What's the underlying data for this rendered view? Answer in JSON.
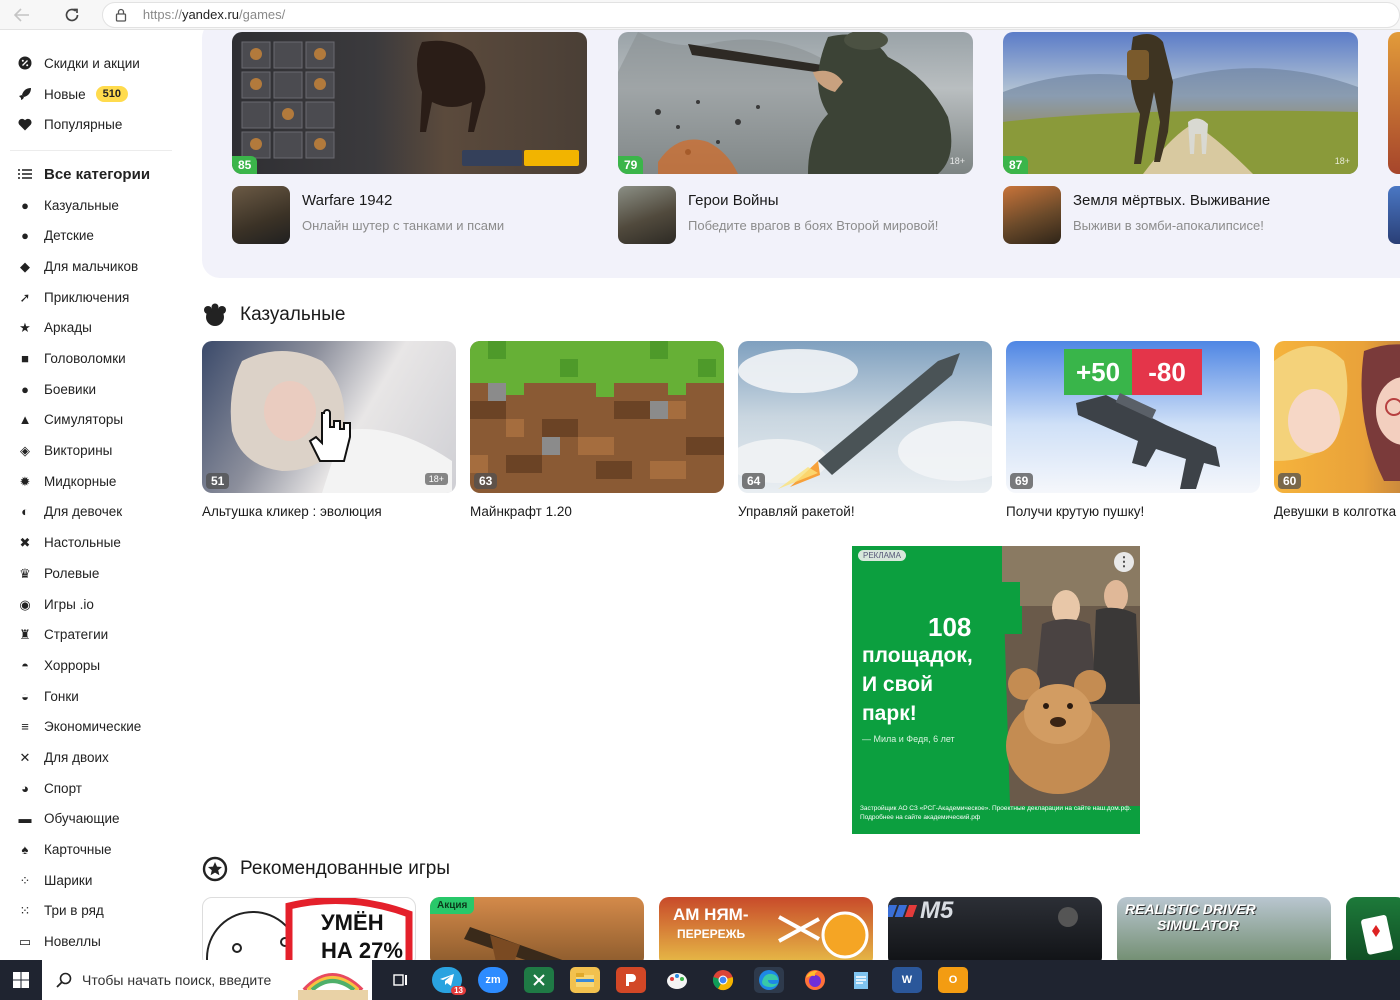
{
  "browser": {
    "url_protocol": "https://",
    "url_host": "yandex.ru",
    "url_path": "/games/"
  },
  "sidebar": {
    "top_items": [
      {
        "label": "Скидки и акции",
        "icon": "percent-icon"
      },
      {
        "label": "Новые",
        "icon": "rocket-icon",
        "badge": "510"
      },
      {
        "label": "Популярные",
        "icon": "heart-icon"
      }
    ],
    "categories_heading": "Все категории",
    "categories": [
      {
        "label": "Казуальные",
        "icon": "casual-icon"
      },
      {
        "label": "Детские",
        "icon": "kids-icon"
      },
      {
        "label": "Для мальчиков",
        "icon": "boys-icon"
      },
      {
        "label": "Приключения",
        "icon": "adventure-icon"
      },
      {
        "label": "Аркады",
        "icon": "arcade-icon"
      },
      {
        "label": "Головоломки",
        "icon": "puzzle-icon"
      },
      {
        "label": "Боевики",
        "icon": "bomb-icon"
      },
      {
        "label": "Симуляторы",
        "icon": "simulator-icon"
      },
      {
        "label": "Викторины",
        "icon": "quiz-icon"
      },
      {
        "label": "Мидкорные",
        "icon": "gear-icon"
      },
      {
        "label": "Для девочек",
        "icon": "girls-icon"
      },
      {
        "label": "Настольные",
        "icon": "board-icon"
      },
      {
        "label": "Ролевые",
        "icon": "crown-icon"
      },
      {
        "label": "Игры .io",
        "icon": "io-icon"
      },
      {
        "label": "Стратегии",
        "icon": "strategy-icon"
      },
      {
        "label": "Хорроры",
        "icon": "ghost-icon"
      },
      {
        "label": "Гонки",
        "icon": "racing-icon"
      },
      {
        "label": "Экономические",
        "icon": "coins-icon"
      },
      {
        "label": "Для двоих",
        "icon": "two-players-icon"
      },
      {
        "label": "Спорт",
        "icon": "sport-icon"
      },
      {
        "label": "Обучающие",
        "icon": "book-icon"
      },
      {
        "label": "Карточные",
        "icon": "cards-icon"
      },
      {
        "label": "Шарики",
        "icon": "balls-icon"
      },
      {
        "label": "Три в ряд",
        "icon": "match3-icon"
      },
      {
        "label": "Новеллы",
        "icon": "novel-icon"
      }
    ]
  },
  "featured": [
    {
      "rating": "85",
      "title": "Warfare 1942",
      "desc": "Онлайн шутер с танками и псами",
      "age": ""
    },
    {
      "rating": "79",
      "title": "Герои Войны",
      "desc": "Победите врагов в боях Второй мировой!",
      "age": "18+"
    },
    {
      "rating": "87",
      "title": "Земля мёртвых. Выживание",
      "desc": "Выживи в зомби-апокалипсисе!",
      "age": "18+"
    }
  ],
  "casual": {
    "title": "Казуальные",
    "games": [
      {
        "rating": "51",
        "title": "Альтушка кликер : эволюция",
        "age": "18+"
      },
      {
        "rating": "63",
        "title": "Майнкрафт 1.20",
        "age": ""
      },
      {
        "rating": "64",
        "title": "Управляй ракетой!",
        "age": ""
      },
      {
        "rating": "69",
        "title": "Получи крутую пушку!",
        "age": ""
      },
      {
        "rating": "60",
        "title": "Девушки в колготка",
        "age": ""
      }
    ],
    "plus_label": "+50",
    "minus_label": "-80"
  },
  "ad": {
    "label": "РЕКЛАМА",
    "number": "108",
    "line1": "площадок,",
    "line2": "И свой",
    "line3": "парк!",
    "quote": "— Мила и Федя, 6 лет",
    "footer": "Застройщик АО СЗ «РСГ-Академическое». Проектные декларации на сайте наш.дом.рф. Подробнее на сайте академический.рф"
  },
  "recommended": {
    "title": "Рекомендованные игры",
    "card1_text1": "УМЁН",
    "card1_text2": "НА 27%",
    "card2_badge": "Акция",
    "card3_text1": "АМ НЯМ-",
    "card3_text2": "ПЕРЕРЕЖЬ",
    "card4_text": "M5",
    "card5_text1": "REALISTIC DRIVER",
    "card5_text2": "SIMULATOR"
  },
  "taskbar": {
    "search_placeholder": "Чтобы начать поиск, введите",
    "apps": [
      "task-view-icon",
      "telegram-icon",
      "zoom-icon",
      "excel-icon",
      "file-explorer-icon",
      "powerpoint-icon",
      "paint-icon",
      "chrome-icon",
      "edge-icon",
      "firefox-icon",
      "notepad-icon",
      "word-icon",
      "outlook-icon"
    ],
    "telegram_badge": "13",
    "zoom_label": "zm",
    "word_label": "W",
    "outlook_label": "O"
  },
  "colors": {
    "accent_green": "#3bb54a",
    "badge_yellow": "#ffdb4d",
    "featured_bg": "#f2f2fa",
    "ad_green": "#0c9f3f"
  }
}
